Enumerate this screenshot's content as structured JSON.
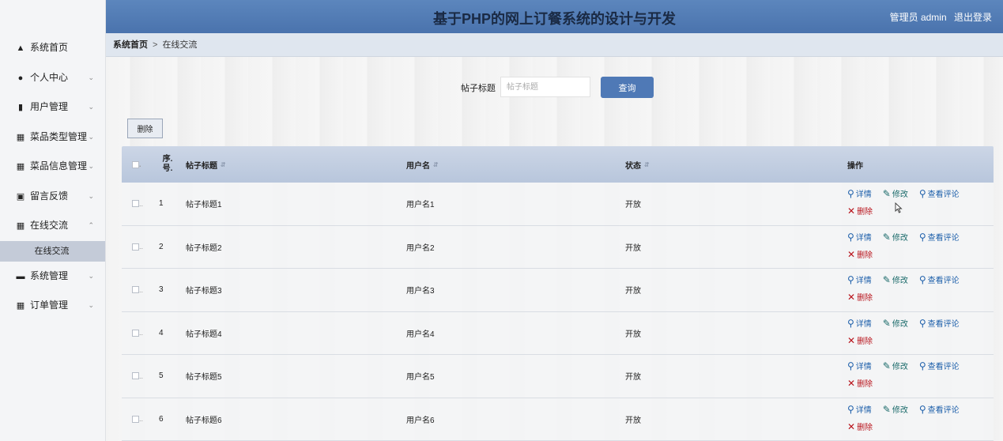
{
  "header": {
    "title": "基于PHP的网上订餐系统的设计与开发",
    "user_label": "管理员 admin",
    "logout_label": "退出登录"
  },
  "sidebar": {
    "items": [
      {
        "label": "系统首页",
        "icon": "home-icon"
      },
      {
        "label": "个人中心",
        "icon": "user-icon"
      },
      {
        "label": "用户管理",
        "icon": "bar-chart-icon"
      },
      {
        "label": "菜品类型管理",
        "icon": "grid-icon"
      },
      {
        "label": "菜品信息管理",
        "icon": "grid-icon"
      },
      {
        "label": "留言反馈",
        "icon": "clipboard-icon"
      },
      {
        "label": "在线交流",
        "icon": "grid-icon"
      },
      {
        "label": "系统管理",
        "icon": "briefcase-icon"
      },
      {
        "label": "订单管理",
        "icon": "grid-icon"
      }
    ],
    "submenu": {
      "label": "在线交流"
    }
  },
  "breadcrumb": {
    "home": "系统首页",
    "separator": ">",
    "current": "在线交流"
  },
  "search": {
    "label": "帖子标题",
    "placeholder": "帖子标题",
    "button": "查询"
  },
  "toolbar": {
    "delete_label": "删除"
  },
  "table": {
    "headers": {
      "num_line1": "序.",
      "num_line2": "号.",
      "title": "帖子标题",
      "user": "用户名",
      "status": "状态",
      "ops": "操作"
    },
    "rows": [
      {
        "num": "1",
        "title": "帖子标题1",
        "user": "用户名1",
        "status": "开放"
      },
      {
        "num": "2",
        "title": "帖子标题2",
        "user": "用户名2",
        "status": "开放"
      },
      {
        "num": "3",
        "title": "帖子标题3",
        "user": "用户名3",
        "status": "开放"
      },
      {
        "num": "4",
        "title": "帖子标题4",
        "user": "用户名4",
        "status": "开放"
      },
      {
        "num": "5",
        "title": "帖子标题5",
        "user": "用户名5",
        "status": "开放"
      },
      {
        "num": "6",
        "title": "帖子标题6",
        "user": "用户名6",
        "status": "开放"
      }
    ],
    "ops": {
      "detail": "详情",
      "edit": "修改",
      "comments": "查看评论",
      "delete": "删除"
    }
  },
  "colors": {
    "header_bg": "#4a73ad",
    "primary_button": "#4f79b6",
    "delete_red": "#b8131b",
    "link_blue": "#1d5faa"
  }
}
